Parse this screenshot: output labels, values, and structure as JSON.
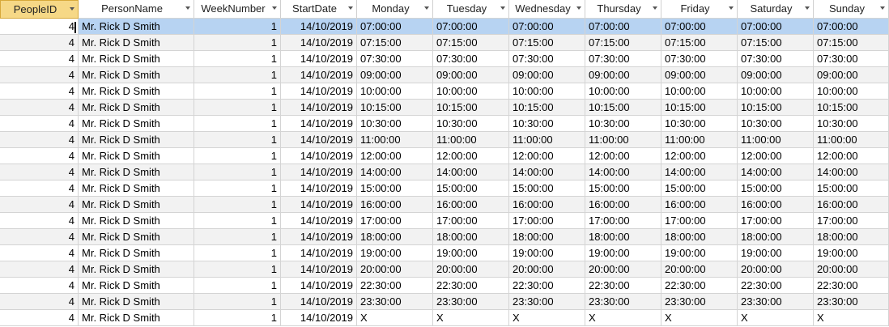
{
  "columns": [
    {
      "key": "PeopleID",
      "label": "PeopleID"
    },
    {
      "key": "PersonName",
      "label": "PersonName"
    },
    {
      "key": "WeekNumber",
      "label": "WeekNumber"
    },
    {
      "key": "StartDate",
      "label": "StartDate"
    },
    {
      "key": "Monday",
      "label": "Monday"
    },
    {
      "key": "Tuesday",
      "label": "Tuesday"
    },
    {
      "key": "Wednesday",
      "label": "Wednesday"
    },
    {
      "key": "Thursday",
      "label": "Thursday"
    },
    {
      "key": "Friday",
      "label": "Friday"
    },
    {
      "key": "Saturday",
      "label": "Saturday"
    },
    {
      "key": "Sunday",
      "label": "Sunday"
    }
  ],
  "rows": [
    {
      "id": "4",
      "name": "Mr. Rick D Smith",
      "week": "1",
      "start": "14/10/2019",
      "time": "07:00:00"
    },
    {
      "id": "4",
      "name": "Mr. Rick D Smith",
      "week": "1",
      "start": "14/10/2019",
      "time": "07:15:00"
    },
    {
      "id": "4",
      "name": "Mr. Rick D Smith",
      "week": "1",
      "start": "14/10/2019",
      "time": "07:30:00"
    },
    {
      "id": "4",
      "name": "Mr. Rick D Smith",
      "week": "1",
      "start": "14/10/2019",
      "time": "09:00:00"
    },
    {
      "id": "4",
      "name": "Mr. Rick D Smith",
      "week": "1",
      "start": "14/10/2019",
      "time": "10:00:00"
    },
    {
      "id": "4",
      "name": "Mr. Rick D Smith",
      "week": "1",
      "start": "14/10/2019",
      "time": "10:15:00"
    },
    {
      "id": "4",
      "name": "Mr. Rick D Smith",
      "week": "1",
      "start": "14/10/2019",
      "time": "10:30:00"
    },
    {
      "id": "4",
      "name": "Mr. Rick D Smith",
      "week": "1",
      "start": "14/10/2019",
      "time": "11:00:00"
    },
    {
      "id": "4",
      "name": "Mr. Rick D Smith",
      "week": "1",
      "start": "14/10/2019",
      "time": "12:00:00"
    },
    {
      "id": "4",
      "name": "Mr. Rick D Smith",
      "week": "1",
      "start": "14/10/2019",
      "time": "14:00:00"
    },
    {
      "id": "4",
      "name": "Mr. Rick D Smith",
      "week": "1",
      "start": "14/10/2019",
      "time": "15:00:00"
    },
    {
      "id": "4",
      "name": "Mr. Rick D Smith",
      "week": "1",
      "start": "14/10/2019",
      "time": "16:00:00"
    },
    {
      "id": "4",
      "name": "Mr. Rick D Smith",
      "week": "1",
      "start": "14/10/2019",
      "time": "17:00:00"
    },
    {
      "id": "4",
      "name": "Mr. Rick D Smith",
      "week": "1",
      "start": "14/10/2019",
      "time": "18:00:00"
    },
    {
      "id": "4",
      "name": "Mr. Rick D Smith",
      "week": "1",
      "start": "14/10/2019",
      "time": "19:00:00"
    },
    {
      "id": "4",
      "name": "Mr. Rick D Smith",
      "week": "1",
      "start": "14/10/2019",
      "time": "20:00:00"
    },
    {
      "id": "4",
      "name": "Mr. Rick D Smith",
      "week": "1",
      "start": "14/10/2019",
      "time": "22:30:00"
    },
    {
      "id": "4",
      "name": "Mr. Rick D Smith",
      "week": "1",
      "start": "14/10/2019",
      "time": "23:30:00"
    },
    {
      "id": "4",
      "name": "Mr. Rick D Smith",
      "week": "1",
      "start": "14/10/2019",
      "time": "X"
    }
  ]
}
